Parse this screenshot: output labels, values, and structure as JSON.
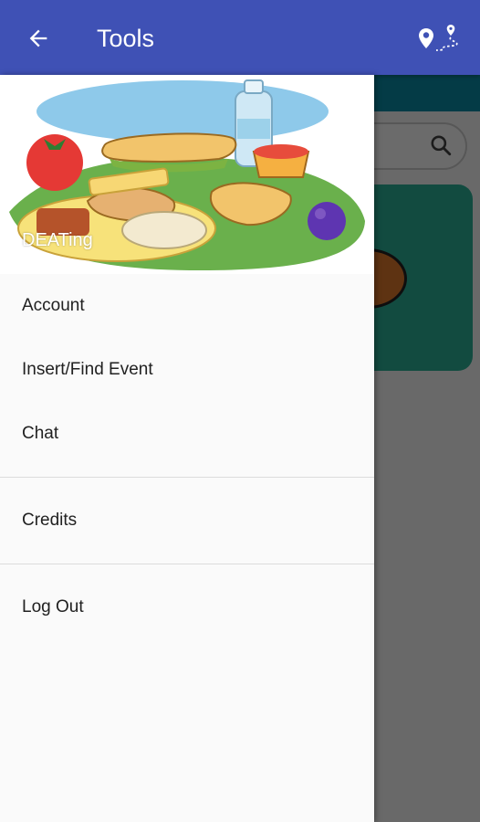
{
  "app_bar": {
    "title": "Tools",
    "back_icon": "arrow-back-icon",
    "route_icon": "location-route-icon",
    "color": "#3f51b5"
  },
  "drawer": {
    "header_label": "DEATing",
    "header_image": "picnic-food-illustration",
    "menu": {
      "group1": [
        {
          "label": "Account"
        },
        {
          "label": "Insert/Find Event"
        },
        {
          "label": "Chat"
        }
      ],
      "group2": [
        {
          "label": "Credits"
        }
      ],
      "group3": [
        {
          "label": "Log Out"
        }
      ]
    }
  },
  "background": {
    "search_icon": "search-icon",
    "accent": "#2bb39a"
  }
}
